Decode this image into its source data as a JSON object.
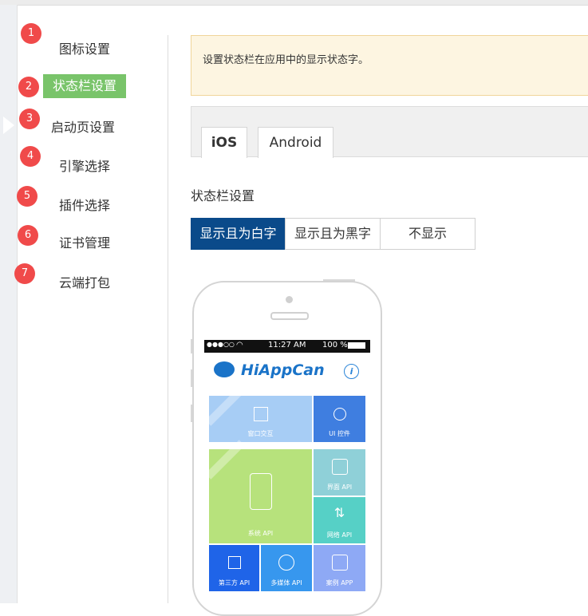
{
  "sidebar": {
    "items": [
      {
        "num": "1",
        "label": "图标设置"
      },
      {
        "num": "2",
        "label": "状态栏设置"
      },
      {
        "num": "3",
        "label": "启动页设置"
      },
      {
        "num": "4",
        "label": "引擎选择"
      },
      {
        "num": "5",
        "label": "插件选择"
      },
      {
        "num": "6",
        "label": "证书管理"
      },
      {
        "num": "7",
        "label": "云端打包"
      }
    ],
    "active_index": 1
  },
  "tip": "设置状态栏在应用中的显示状态字。",
  "tabs": [
    {
      "label": "iOS",
      "active": true
    },
    {
      "label": "Android",
      "active": false
    }
  ],
  "section_title": "状态栏设置",
  "options": [
    {
      "label": "显示且为白字",
      "active": true
    },
    {
      "label": "显示且为黑字",
      "active": false
    },
    {
      "label": "不显示",
      "active": false
    }
  ],
  "phone": {
    "status": {
      "signal": "●●●○○",
      "time": "11:27 AM",
      "battery": "100 %"
    },
    "app_name": "HiAppCan",
    "tiles": [
      {
        "label": "窗口交互",
        "color": "#a7cdf5"
      },
      {
        "label": "UI 控件",
        "color": "#3f7ee0"
      },
      {
        "label": "系统 API",
        "color": "#b7e27c"
      },
      {
        "label": "界面 API",
        "color": "#8fd0d8"
      },
      {
        "label": "网络 API",
        "color": "#56d0c6"
      },
      {
        "label": "第三方 API",
        "color": "#1f64e8"
      },
      {
        "label": "多媒体 API",
        "color": "#3797ee"
      },
      {
        "label": "案例 APP",
        "color": "#8ea9f5"
      }
    ]
  },
  "colors": {
    "badge": "#f04a4a",
    "active_nav": "#79c46a",
    "active_option": "#0a4a8a",
    "tip_bg": "#fdf5e1"
  }
}
